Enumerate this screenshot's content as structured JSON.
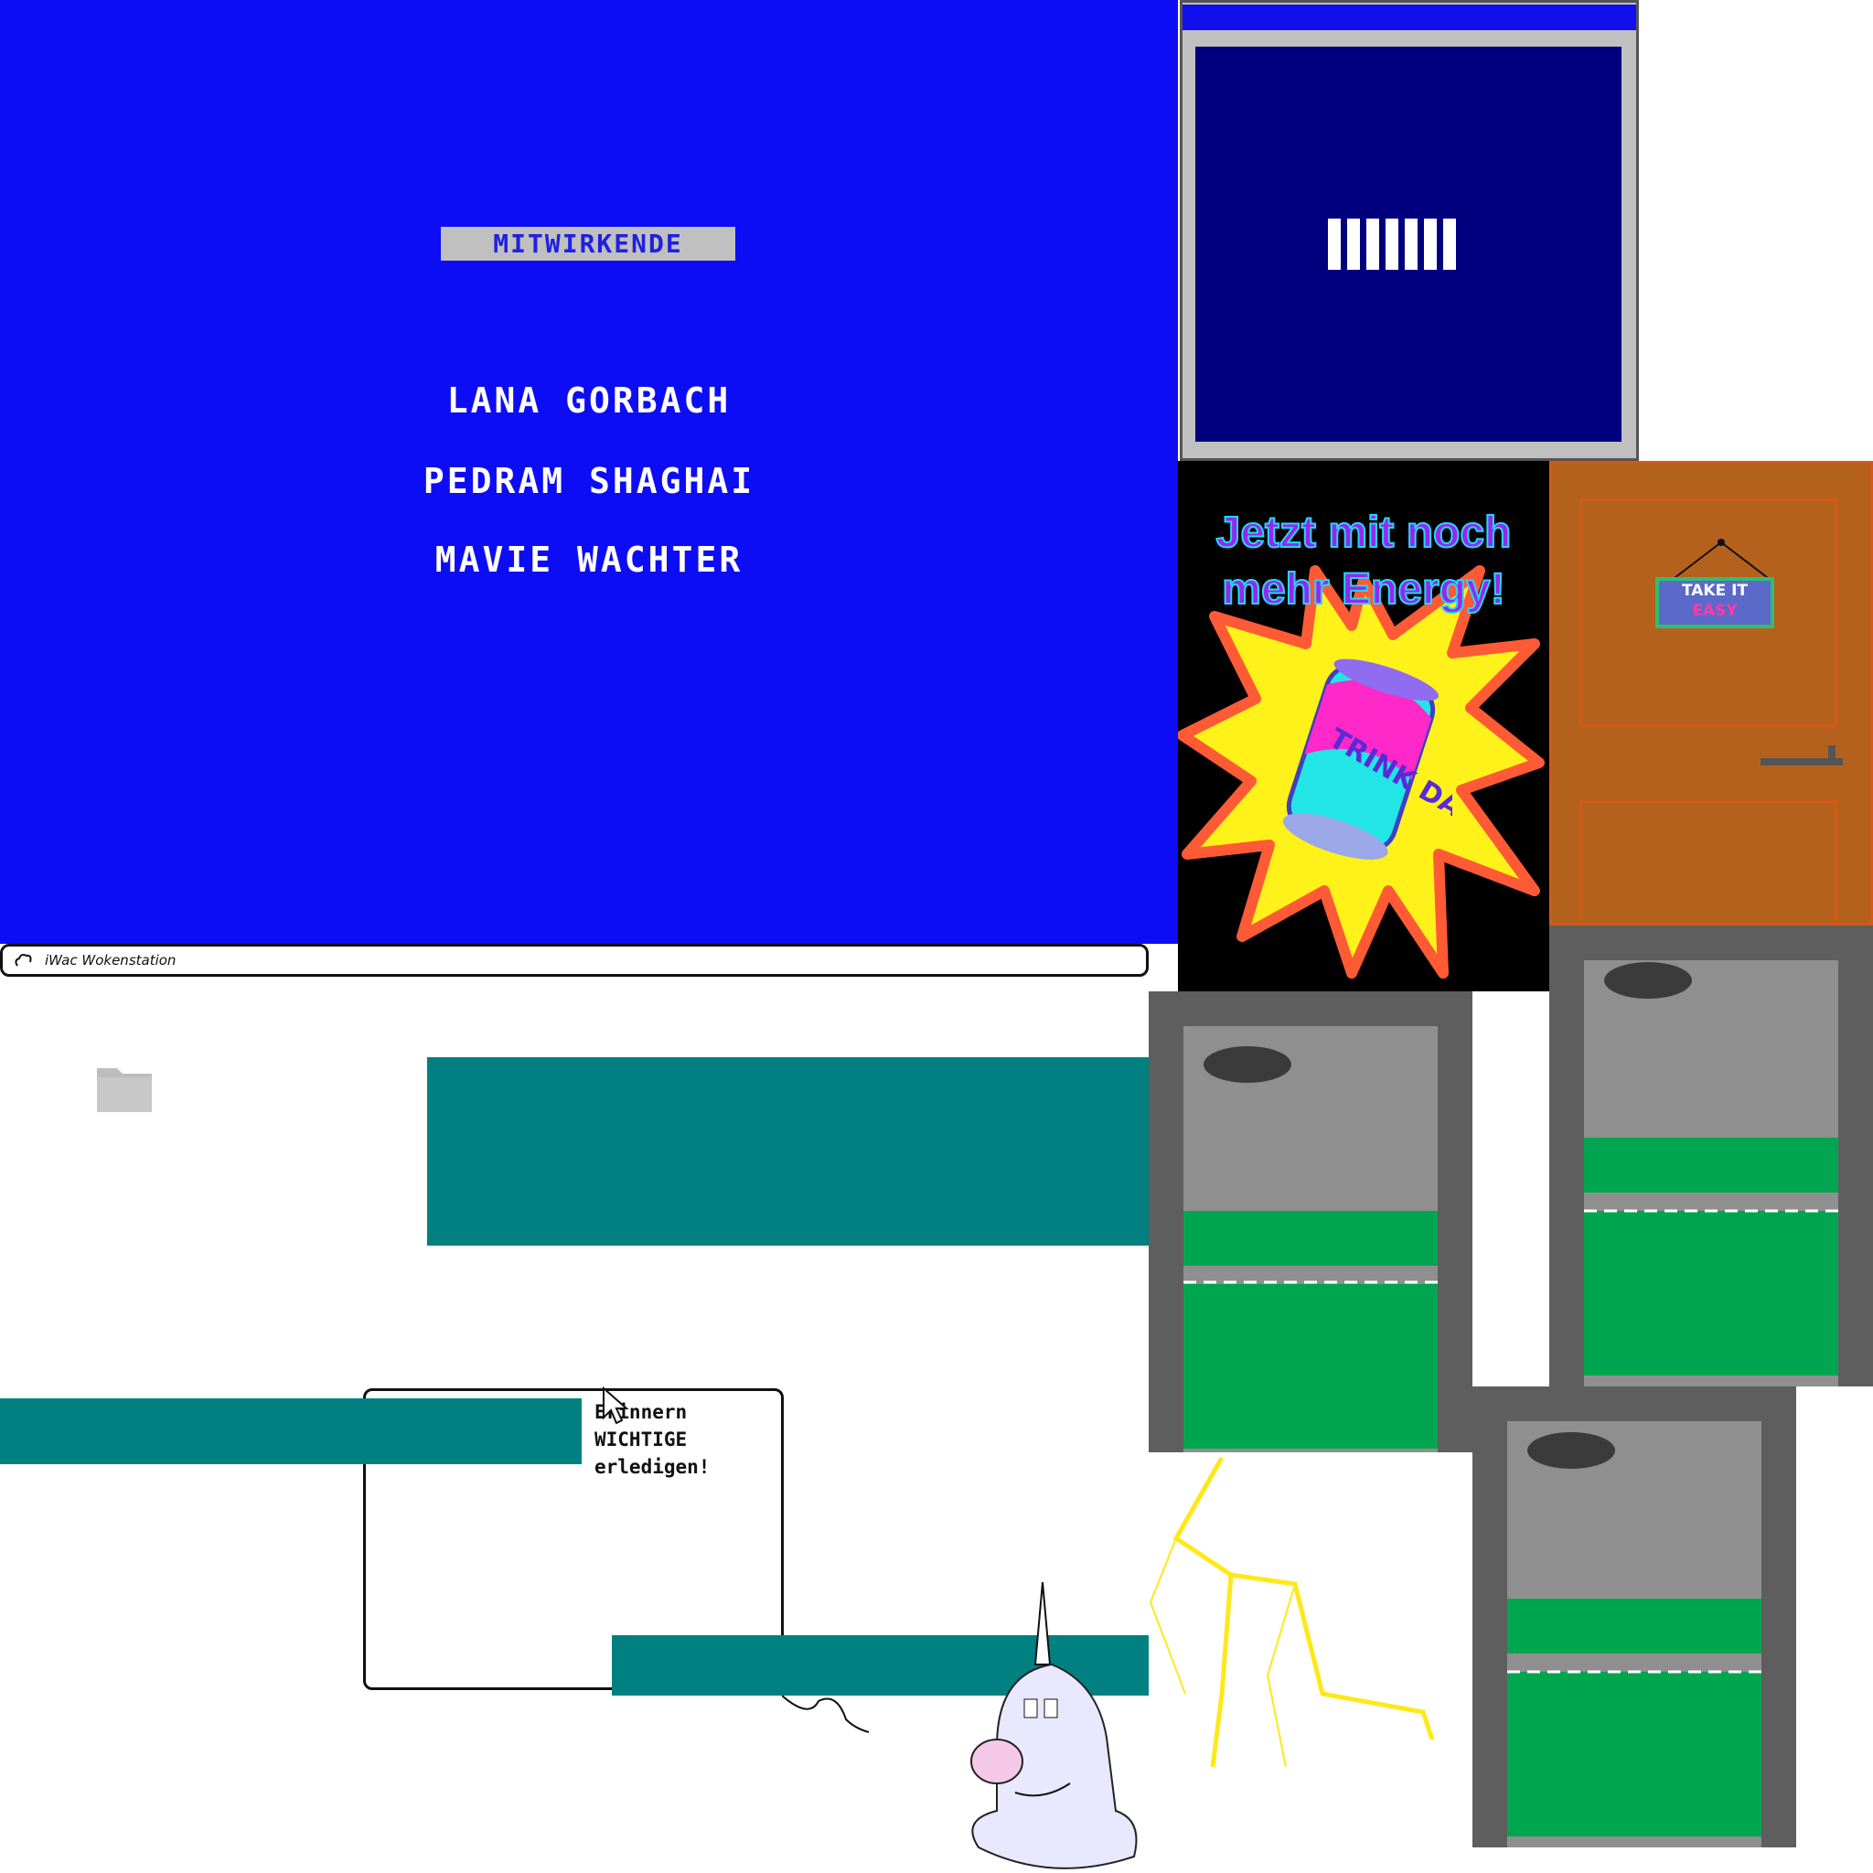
{
  "credits": {
    "title": "MITWIRKENDE",
    "names": [
      "LANA GORBACH",
      "PEDRAM SHAGHAI",
      "MAVIE WACHTER"
    ]
  },
  "loader": {
    "progress_blocks": 7
  },
  "ad": {
    "headline_line1": "Jetzt mit noch",
    "headline_line2": "mehr Energy!",
    "can_label": "TRINK DAS"
  },
  "door": {
    "sign_line1": "TAKE IT",
    "sign_line2": "EASY"
  },
  "taskbar": {
    "title": "iWac Wokenstation"
  },
  "note": {
    "line1": "Erinnern",
    "line2": "WICHTIGE",
    "line3": "erledigen!"
  },
  "colors": {
    "credits_bg": "#0d0df5",
    "teal": "#008080",
    "loader_screen": "#00007f",
    "door": "#b5611e"
  }
}
